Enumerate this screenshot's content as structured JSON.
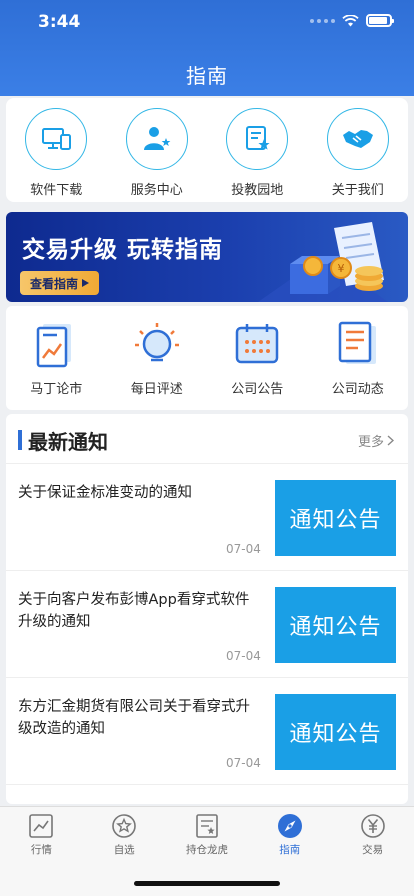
{
  "status_bar": {
    "time": "3:44"
  },
  "header": {
    "title": "指南"
  },
  "quick_links": [
    {
      "label": "软件下载",
      "icon": "computer-icon"
    },
    {
      "label": "服务中心",
      "icon": "service-person-icon"
    },
    {
      "label": "投教园地",
      "icon": "document-star-icon"
    },
    {
      "label": "关于我们",
      "icon": "handshake-icon"
    }
  ],
  "banner": {
    "title": "交易升级 玩转指南",
    "button_label": "查看指南"
  },
  "categories": [
    {
      "label": "马丁论市",
      "icon": "chart-document-icon"
    },
    {
      "label": "每日评述",
      "icon": "lightbulb-icon"
    },
    {
      "label": "公司公告",
      "icon": "calendar-icon"
    },
    {
      "label": "公司动态",
      "icon": "news-document-icon"
    }
  ],
  "news": {
    "title": "最新通知",
    "more_label": "更多",
    "items": [
      {
        "text": "关于保证金标准变动的通知",
        "date": "07-04",
        "tag": "通知公告"
      },
      {
        "text": "关于向客户发布彭博App看穿式软件升级的通知",
        "date": "07-04",
        "tag": "通知公告"
      },
      {
        "text": "东方汇金期货有限公司关于看穿式升级改造的通知",
        "date": "07-04",
        "tag": "通知公告"
      }
    ]
  },
  "tabs": [
    {
      "label": "行情",
      "icon": "market-chart-icon"
    },
    {
      "label": "自选",
      "icon": "star-icon"
    },
    {
      "label": "持仓龙虎",
      "icon": "ranking-list-icon"
    },
    {
      "label": "指南",
      "icon": "compass-icon",
      "active": true
    },
    {
      "label": "交易",
      "icon": "yuan-icon"
    }
  ],
  "colors": {
    "primary": "#2f6fd6",
    "accent": "#1a9fe6",
    "icon_cyan": "#33b7e6",
    "banner_gold": "#f0a935"
  }
}
